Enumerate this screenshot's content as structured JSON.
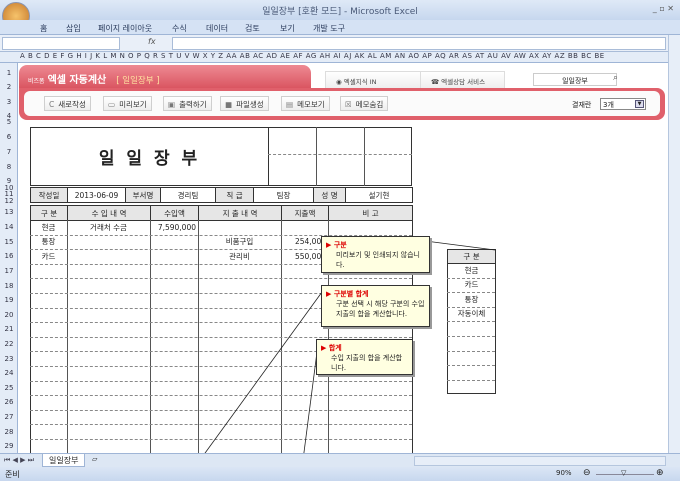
{
  "window": {
    "title": "일일장부  [호환 모드] - Microsoft Excel"
  },
  "ribbon_tabs": [
    "홈",
    "삽입",
    "페이지 레이아웃",
    "수식",
    "데이터",
    "검토",
    "보기",
    "개발 도구"
  ],
  "formula_bar": {
    "fx": "fx",
    "value": ""
  },
  "columns": "A B C D E F G H I J K L M N O P Q R S T U V W X Y Z AA AB AC AD AE AF AG AH AI AJ AK AL AM AN AO AP AQ AR AS AT AU AV AW AX AY AZ BB BC BE",
  "rows": [
    "1",
    "2",
    "3",
    "4",
    "5",
    "6",
    "7",
    "8",
    "9",
    "10",
    "11",
    "12",
    "13",
    "14",
    "15",
    "16",
    "17",
    "18",
    "19",
    "20",
    "21",
    "22",
    "23",
    "24",
    "25",
    "26",
    "27",
    "28",
    "29"
  ],
  "banner": {
    "brand_small": "비즈폼",
    "brand": "엑셀 자동계산",
    "subtitle": "[ 일일장부 ]",
    "tabs": [
      "엑셀지식 IN",
      "엑셀상담 서비스"
    ],
    "search_value": "일일장부",
    "buttons": [
      "새로작성",
      "미리보기",
      "출력하기",
      "파일생성",
      "메모보기",
      "메모숨김"
    ],
    "approval_label": "결재란",
    "approval_value": "3개"
  },
  "sheet": {
    "title": "일 일 장 부",
    "info": {
      "date_label": "작성일",
      "date": "2013-06-09",
      "dept_label": "부서명",
      "dept": "경리팀",
      "rank_label": "직 급",
      "rank": "팀장",
      "name_label": "성 명",
      "name": "설기현"
    },
    "headers": [
      "구 분",
      "수 입 내 역",
      "수입액",
      "지 출 내 역",
      "지출액",
      "비 고"
    ],
    "rows": [
      [
        "현금",
        "거래처 수금",
        "7,590,000",
        "",
        "",
        ""
      ],
      [
        "통장",
        "",
        "",
        "비품구입",
        "254,000",
        ""
      ],
      [
        "카드",
        "",
        "",
        "관리비",
        "550,000",
        ""
      ]
    ]
  },
  "side_table": {
    "header": "구 분",
    "items": [
      "현금",
      "카드",
      "통장",
      "자동이체"
    ]
  },
  "notes": [
    {
      "title": "구분",
      "body": "미리보기 및 인쇄되지 않습니다."
    },
    {
      "title": "구분별 합계",
      "body": "구분 선택 시 해당 구분의 수입 지출의 합을 계산합니다."
    },
    {
      "title": "합계",
      "body": "수입 지출의 합을 계산합니다."
    }
  ],
  "sheet_tab": "일일장부",
  "status": {
    "text": "준비",
    "zoom": "90%"
  }
}
